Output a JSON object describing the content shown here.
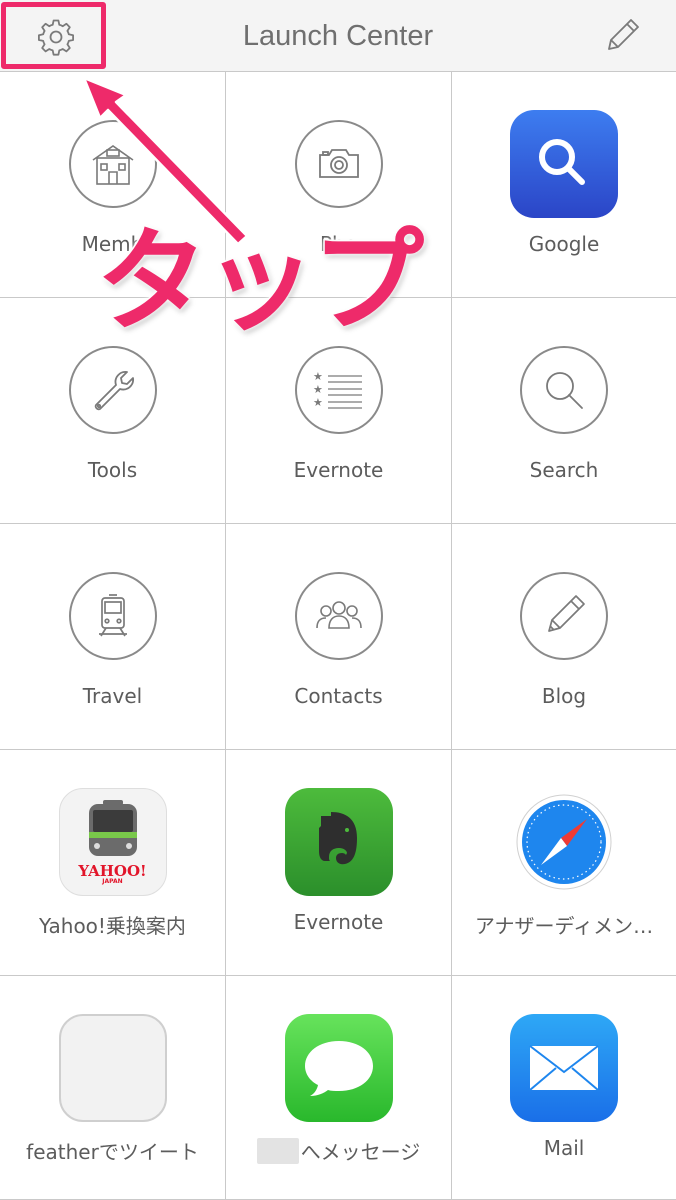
{
  "navbar": {
    "title": "Launch Center",
    "settings_icon": "gear-icon",
    "edit_icon": "pencil-icon"
  },
  "annotation": {
    "text": "タップ",
    "color": "#ee2a6a"
  },
  "grid": [
    {
      "label": "Memb",
      "icon": "house-icon"
    },
    {
      "label": "Pho",
      "icon": "camera-icon"
    },
    {
      "label": "Google",
      "icon": "google-search-app-icon"
    },
    {
      "label": "Tools",
      "icon": "wrench-icon"
    },
    {
      "label": "Evernote",
      "icon": "starred-list-icon"
    },
    {
      "label": "Search",
      "icon": "magnifier-icon"
    },
    {
      "label": "Travel",
      "icon": "train-icon"
    },
    {
      "label": "Contacts",
      "icon": "people-icon"
    },
    {
      "label": "Blog",
      "icon": "pencil-icon"
    },
    {
      "label": "Yahoo!乗換案内",
      "icon": "yahoo-transit-app-icon",
      "icon_text": "YAHOO!",
      "icon_subtext": "JAPAN"
    },
    {
      "label": "Evernote",
      "icon": "evernote-app-icon"
    },
    {
      "label": "アナザーディメン…",
      "icon": "safari-app-icon"
    },
    {
      "label": "featherでツイート",
      "icon": "blank-app-icon"
    },
    {
      "label": "へメッセージ",
      "icon": "messages-app-icon"
    },
    {
      "label": "Mail",
      "icon": "mail-app-icon"
    }
  ],
  "colors": {
    "accent": "#ee2a6a",
    "google_icon": "#2b5fd8",
    "evernote_icon": "#3aa335",
    "messages_icon": "#3fcb4a",
    "mail_icon": "#1e86ee"
  }
}
